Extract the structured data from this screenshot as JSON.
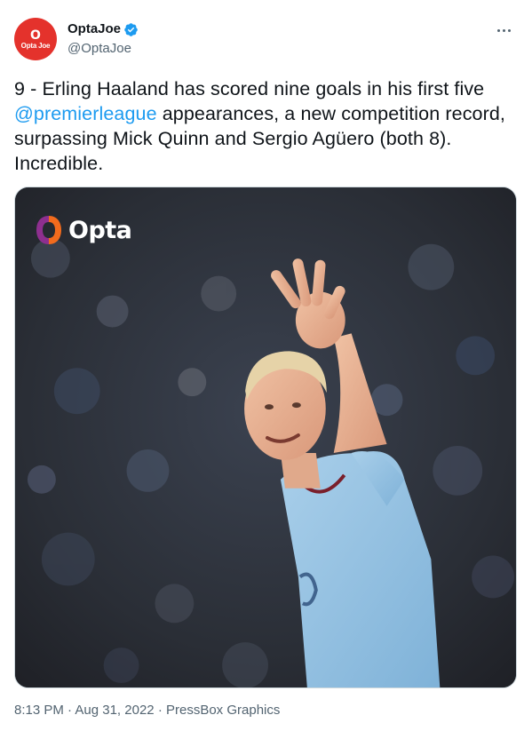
{
  "author": {
    "display_name": "OptaJoe",
    "handle": "@OptaJoe",
    "avatar_text": "Opta Joe",
    "avatar_glyph": "O",
    "avatar_color": "#e4322c",
    "verified": true
  },
  "tweet": {
    "text_before": "9 - Erling Haaland has scored nine goals in his first five ",
    "mention": "@premierleague",
    "text_after": " appearances, a new competition record, surpassing Mick Quinn and Sergio Agüero (both 8). Incredible."
  },
  "media": {
    "watermark": "Opta",
    "description_icon": "photo"
  },
  "footer": {
    "time": "8:13 PM",
    "separator": "·",
    "date": "Aug 31, 2022",
    "source": "PressBox Graphics"
  },
  "colors": {
    "link": "#1d9bf0",
    "secondary_text": "#536471",
    "verified": "#1d9bf0",
    "opta_orange": "#f26b1d",
    "opta_purple": "#8e2f8f"
  }
}
